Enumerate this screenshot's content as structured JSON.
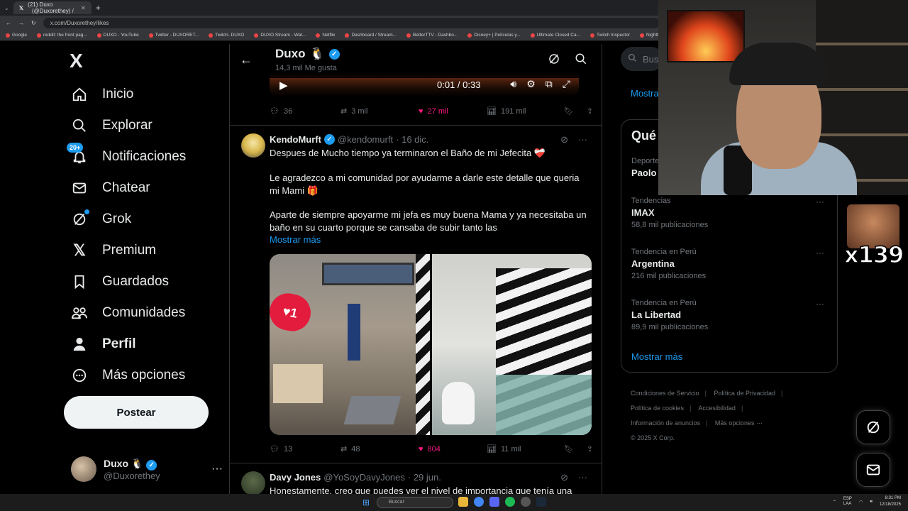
{
  "browser": {
    "tabs": [
      {
        "title": "(21) Duxo ⠀(@Duxorethey) /"
      },
      {
        "title": "(@Duxorethey) /"
      }
    ],
    "url": "x.com/Duxorethey/likes",
    "bookmarks": [
      "Google",
      "reddit: the front pag...",
      "DUXO - YouTube",
      "Twitter - DUXORET...",
      "Twitch- DUXO",
      "DUXO Stream - Wat...",
      "Netflix",
      "Dashboard / Stream...",
      "BetterTTV - Dashbo...",
      "Disney+ | Películas y...",
      "Ultimate Closed Ca...",
      "Twitch Inspector",
      "Nightbot - Comma...",
      "Imgu"
    ]
  },
  "nav": {
    "logo": "X",
    "items": [
      {
        "label": "Inicio",
        "icon": "home-icon"
      },
      {
        "label": "Explorar",
        "icon": "search-icon"
      },
      {
        "label": "Notificaciones",
        "icon": "bell-icon",
        "badge": "20+"
      },
      {
        "label": "Chatear",
        "icon": "mail-icon"
      },
      {
        "label": "Grok",
        "icon": "grok-icon"
      },
      {
        "label": "Premium",
        "icon": "x-logo-icon"
      },
      {
        "label": "Guardados",
        "icon": "bookmark-icon"
      },
      {
        "label": "Comunidades",
        "icon": "communities-icon"
      },
      {
        "label": "Perfil",
        "icon": "person-icon"
      },
      {
        "label": "Más opciones",
        "icon": "more-circle-icon"
      }
    ],
    "post_button": "Postear",
    "account": {
      "name": "Duxo",
      "emoji": "🐧",
      "handle": "@Duxorethey"
    }
  },
  "header": {
    "title": "Duxo",
    "emoji": "🐧",
    "subtitle": "14,3 mil Me gusta"
  },
  "video": {
    "time": "0:01 / 0:33"
  },
  "tweet1_actions": {
    "replies": "36",
    "reposts": "3 mil",
    "likes": "27 mil",
    "views": "191 mil"
  },
  "tweet2": {
    "name": "KendoMurft",
    "handle": "@kendomurft",
    "date": "· 16 dic.",
    "para1": "Despues de Mucho tiempo ya terminaron el Baño de mi Jefecita ❤️‍🩹",
    "para2": "Le agradezco a mi comunidad por ayudarme a darle este detalle que queria mi Mami 🎁",
    "para3": "Aparte de siempre apoyarme mi jefa es muy buena Mama y ya necesitaba un baño en su cuarto porque se cansaba de subir tanto las",
    "show_more": "Mostrar más",
    "sticker": "1",
    "actions": {
      "replies": "13",
      "reposts": "48",
      "likes": "804",
      "views": "11 mil"
    }
  },
  "tweet3": {
    "name": "Davy Jones",
    "handle": "@YoSoyDavyJones",
    "date": "· 29 jun.",
    "text": "Honestamente, creo que puedes ver el nivel de importancia que tenía una"
  },
  "right": {
    "search_placeholder": "Busc",
    "show_more_top": "Mostra",
    "card_title": "Qué",
    "trends": [
      {
        "category": "Deporte",
        "name": "Paolo",
        "count": ""
      },
      {
        "category": "Tendencias",
        "name": "IMAX",
        "count": "58,8 mil publicaciones"
      },
      {
        "category": "Tendencia en Perú",
        "name": "Argentina",
        "count": "216 mil publicaciones"
      },
      {
        "category": "Tendencia en Perú",
        "name": "La Libertad",
        "count": "89,9 mil publicaciones"
      }
    ],
    "card_more": "Mostrar más",
    "footer": [
      "Condiciones de Servicio",
      "Política de Privacidad",
      "Política de cookies",
      "Accesibilidad",
      "Información de anuncios",
      "Más opciones ···",
      "© 2025 X Corp."
    ]
  },
  "overlay": {
    "emote_count": "x139"
  },
  "taskbar": {
    "search": "Buscar",
    "lang": "ESP\nLAA",
    "time": "8:31 PM",
    "date": "12/18/2025"
  },
  "colors": {
    "accent": "#1d9bf0",
    "like": "#f91880",
    "bg": "#000000",
    "border": "#2f3336"
  }
}
